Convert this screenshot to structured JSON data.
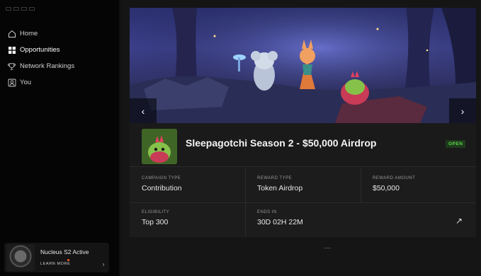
{
  "sidebar": {
    "nav": [
      {
        "label": "Home",
        "icon": "home-icon"
      },
      {
        "label": "Opportunities",
        "icon": "grid-icon"
      },
      {
        "label": "Network Rankings",
        "icon": "trophy-icon"
      },
      {
        "label": "You",
        "icon": "user-icon"
      }
    ],
    "promo": {
      "title": "Nucleus S2 Active",
      "link": "LEARN MORE",
      "arrow": "›"
    }
  },
  "campaign": {
    "title": "Sleepagotchi Season 2 - $50,000 Airdrop",
    "status": "OPEN",
    "details": [
      {
        "label": "CAMPAIGN TYPE",
        "value": "Contribution"
      },
      {
        "label": "REWARD TYPE",
        "value": "Token Airdrop"
      },
      {
        "label": "REWARD AMOUNT",
        "value": "$50,000"
      },
      {
        "label": "ELIGIBILITY",
        "value": "Top 300"
      },
      {
        "label": "ENDS IN",
        "value": "30D 02H 22M"
      }
    ],
    "prev_arrow": "‹",
    "next_arrow": "›",
    "external_icon": "↗"
  },
  "colors": {
    "accent_open": "#5ad64a",
    "promo_dot": "#ff5a28"
  }
}
